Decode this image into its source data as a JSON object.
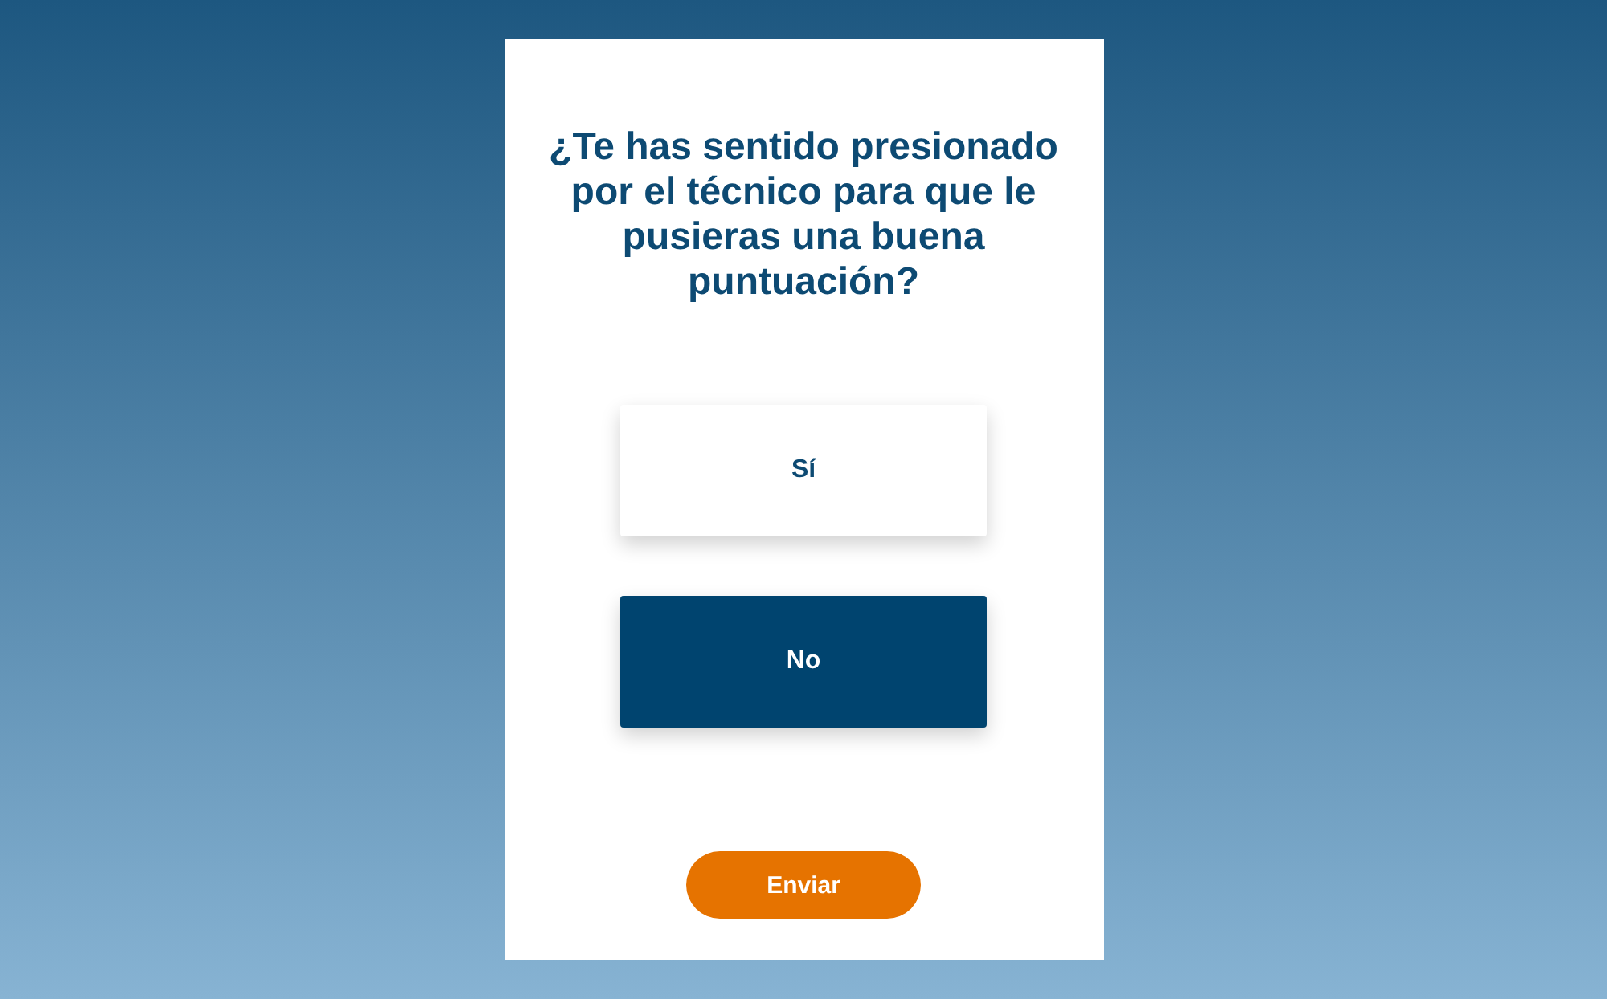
{
  "question": "¿Te has sentido presionado por el técnico para que le pusieras una buena puntuación?",
  "options": [
    {
      "label": "Sí",
      "selected": false
    },
    {
      "label": "No",
      "selected": true
    }
  ],
  "submit_button": "Enviar"
}
